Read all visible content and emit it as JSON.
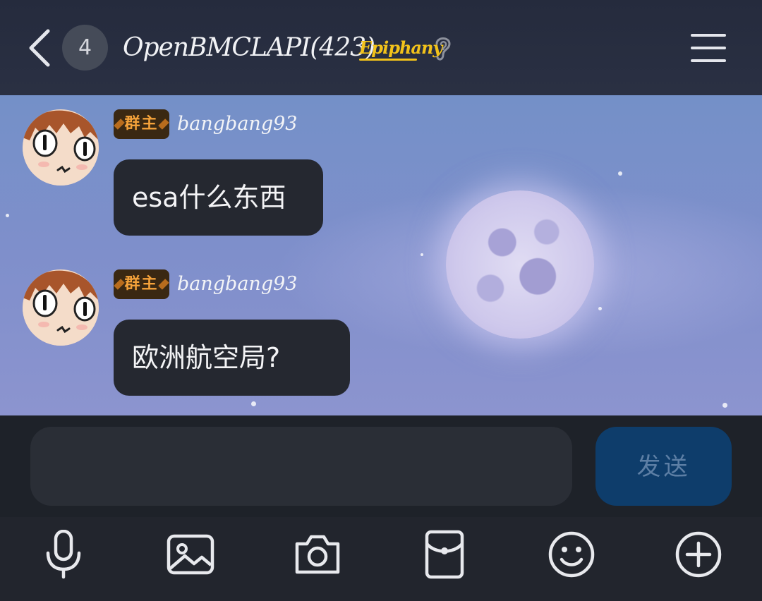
{
  "header": {
    "unread_count": "4",
    "title": "OpenBMCLAPI(423)",
    "badge_text": "Epiphany",
    "icons": [
      "back-icon",
      "ear-icon",
      "menu-icon"
    ]
  },
  "messages": [
    {
      "role": "群主",
      "sender": "bangbang93",
      "text": "esa什么东西"
    },
    {
      "role": "群主",
      "sender": "bangbang93",
      "text": "欧洲航空局?"
    }
  ],
  "composer": {
    "input_value": "",
    "input_placeholder": "",
    "send_label": "发送"
  },
  "toolbar": {
    "icons": [
      "microphone-icon",
      "image-icon",
      "camera-icon",
      "red-packet-icon",
      "emoji-icon",
      "plus-icon"
    ]
  },
  "colors": {
    "header_bg": "#252b3d",
    "chat_bg": "#7a90c9",
    "bubble_bg": "#252830",
    "send_button_bg": "#0e3d6b",
    "role_badge_text": "#f4a23a",
    "epiphany_gold": "#f2c21a"
  }
}
